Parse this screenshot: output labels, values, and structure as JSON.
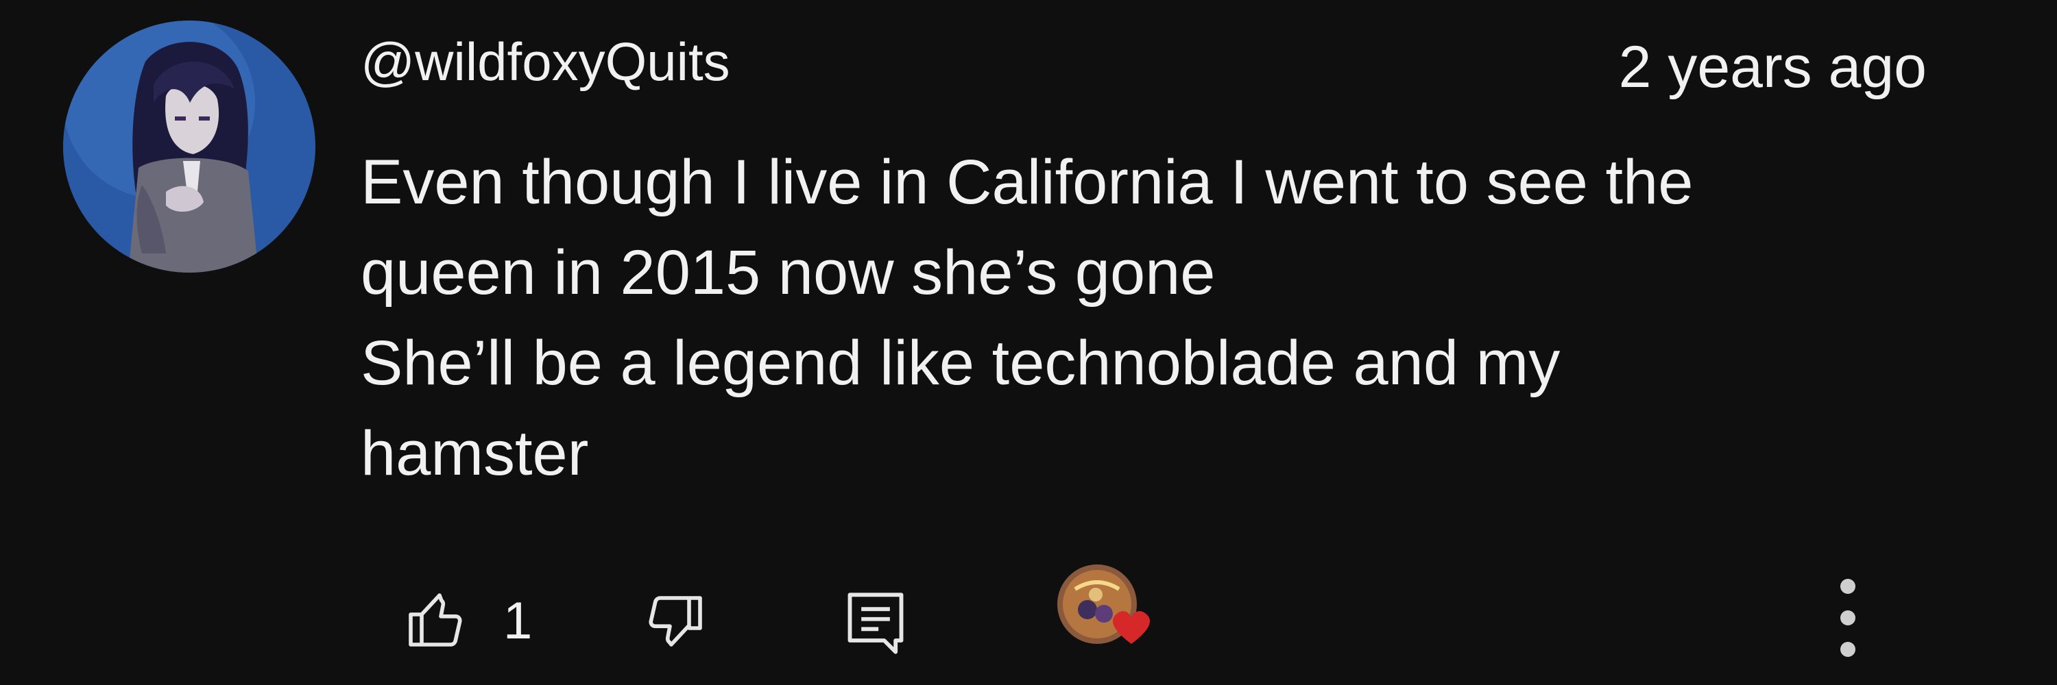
{
  "comment": {
    "author": "@wildfoxyQuits",
    "timestamp": "2 years ago",
    "body_lines": [
      "Even though I live in California I went to see the",
      "queen in 2015 now she’s gone",
      "She’ll be a legend like technoblade and my",
      "hamster"
    ]
  },
  "actions": {
    "like_count": "1",
    "icons": {
      "like": "thumbs-up-icon",
      "dislike": "thumbs-down-icon",
      "reply": "reply-comment-icon",
      "creator_heart": "creator-heart-badge",
      "more": "more-vertical-icon"
    }
  },
  "colors": {
    "background": "#0f0f0f",
    "text": "#f1f1f1",
    "heart": "#d62828"
  }
}
